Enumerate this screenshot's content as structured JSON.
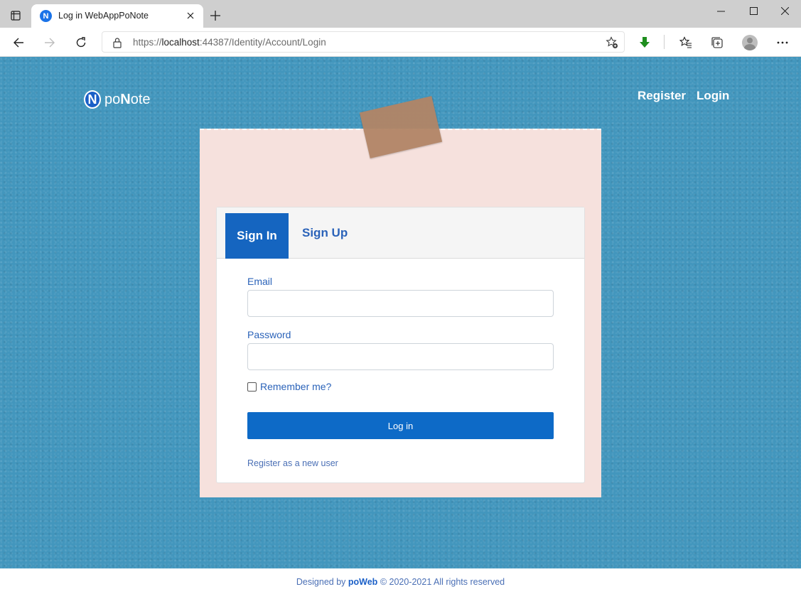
{
  "browser": {
    "tab_title": "Log in WebAppPoNote",
    "favicon_letter": "N",
    "url_prefix": "https://",
    "url_host": "localhost",
    "url_rest": ":44387/Identity/Account/Login",
    "icons": [
      "tab-actions-icon",
      "close-icon",
      "plus-icon",
      "minimize-icon",
      "maximize-icon",
      "close-window-icon",
      "back-icon",
      "forward-icon",
      "refresh-icon",
      "lock-icon",
      "add-favorite-icon",
      "download-icon",
      "favorites-icon",
      "collections-icon",
      "profile-icon",
      "more-icon"
    ]
  },
  "header": {
    "brand_letter": "N",
    "brand_po": "po",
    "brand_n": "N",
    "brand_rest": "ote",
    "nav": {
      "register": "Register",
      "login": "Login"
    }
  },
  "card": {
    "tabs": {
      "signin": "Sign In",
      "signup": "Sign Up"
    },
    "email_label": "Email",
    "email_value": "",
    "password_label": "Password",
    "password_value": "",
    "remember_label": "Remember me?",
    "remember_checked": false,
    "login_button": "Log in",
    "register_link": "Register as a new user"
  },
  "footer": {
    "prefix": "Designed by",
    "brand": "poWeb",
    "suffix": "© 2020-2021 All rights reserved"
  },
  "colors": {
    "background": "#4296bd",
    "note": "#f6e1dd",
    "primary": "#1565c0",
    "link": "#2b63b9"
  }
}
